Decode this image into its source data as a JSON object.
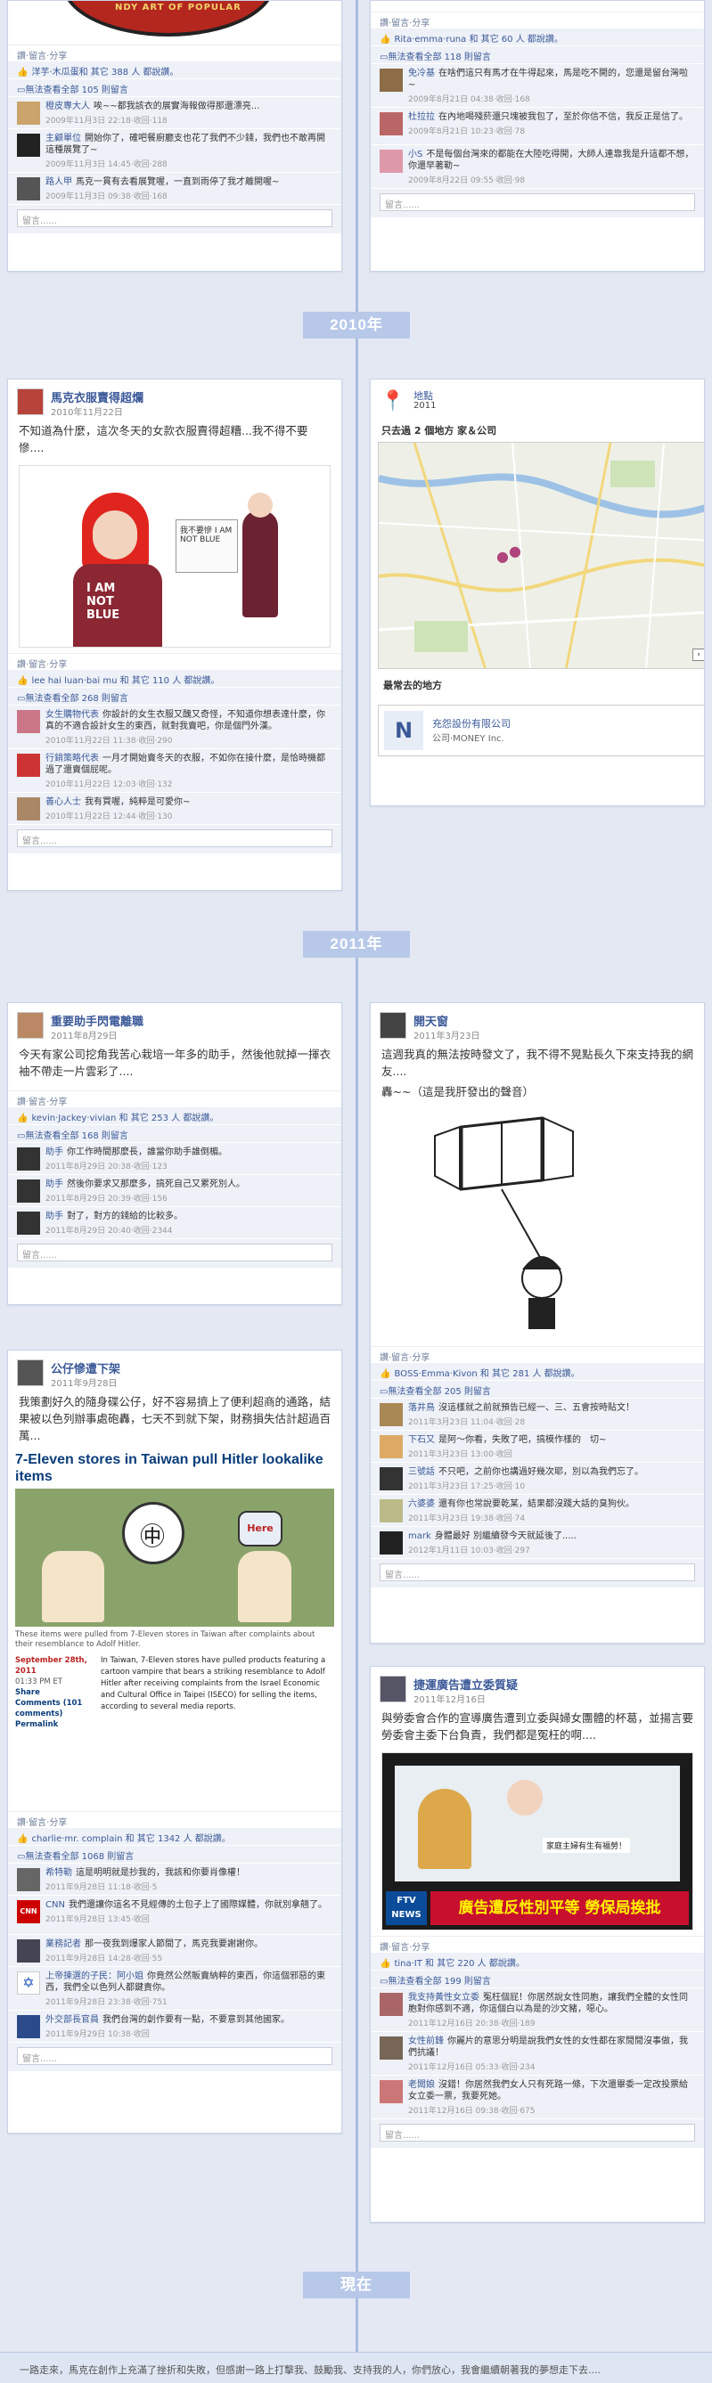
{
  "years": [
    "2010年",
    "2011年",
    "現在"
  ],
  "common": {
    "actions": "讚‧留言‧分享",
    "comment_placeholder": "留言......"
  },
  "cards": {
    "top_left": {
      "likes": "洋芋‧木瓜蛋和 其它 388 人 都說讚。",
      "view_all": "無法查看全部 105 則留言",
      "comments": [
        {
          "name": "橙皮專大人",
          "text": "唉~~都我該衣的展實海報做得那還漂亮...",
          "meta": "2009年11月3日 22:18‧收回‧118"
        },
        {
          "name": "主顧單位",
          "text": "開始你了，確吧餐廚廳支也花了我們不少錢，我們也不敢再開這種展覽了~",
          "meta": "2009年11月3日 14:45‧收回‧288"
        },
        {
          "name": "路人甲",
          "text": "馬克一貫有去看展覽喔，一直到雨停了我才離開喔~",
          "meta": "2009年11月3日 09:38‧收回‧168"
        }
      ]
    },
    "top_right": {
      "likes": "Rita‧emma‧runa 和 其它 60 人 都說讚。",
      "view_all": "無法查看全部 118 則留言",
      "comments": [
        {
          "name": "免冷基",
          "text": "在啥們這只有馬才在牛得起來，馬是吃不開的，您還是留台灣啦~",
          "meta": "2009年8月21日 04:38‧收回‧168"
        },
        {
          "name": "杜拉拉",
          "text": "在內地喝殘菸還只塊被我包了，至於你信不信，我反正是信了。",
          "meta": "2009年8月21日 10:23‧收回‧78"
        },
        {
          "name": "小S",
          "text": "不是每個台灣來的都能在大陸吃得開，大師人連靠我是升這都不想，你還早著勒~",
          "meta": "2009年8月22日 09:55‧收回‧98"
        }
      ]
    },
    "c2010_left": {
      "title": "馬克衣服賣得超爛",
      "date": "2010年11月22日",
      "body": "不知道為什麼，這次冬天的女款衣服賣得超糟...我不得不要慘....",
      "photo_text": "我不要慘 I AM NOT BLUE",
      "likes": "lee hai luan‧bai mu 和 其它 110 人 都說讚。",
      "view_all": "無法查看全部 268 則留言",
      "comments": [
        {
          "name": "女生購物代表",
          "text": "你設計的女生衣服又醜又奇怪，不知道你想表達什麼，你真的不適合設計女生的東西，就對我賣吧，你是個門外漢。",
          "meta": "2010年11月22日 11:38‧收回‧290"
        },
        {
          "name": "行銷策略代表",
          "text": "一月才開始賣冬天的衣服，不如你在接什麼，是恰時機都過了還賣個屁呢。",
          "meta": "2010年11月22日 12:03‧收回‧132"
        },
        {
          "name": "善心人士",
          "text": "我有買喔，純粹是可愛你~",
          "meta": "2010年11月22日 12:44‧收回‧130"
        }
      ]
    },
    "c2010_right": {
      "title": "地點",
      "date": "2011",
      "subtitle": "只去過 2 個地方 家＆公司",
      "map_label": "最常去的地方",
      "place_name": "充怨設份有限公司",
      "place_type": "公司‧MONEY Inc."
    },
    "c2011_a": {
      "title": "重要助手閃電離職",
      "date": "2011年8月29日",
      "body": "今天有家公司挖角我苦心栽培一年多的助手，然後他就掉一揮衣袖不帶走一片雲彩了....",
      "likes": "kevin‧Jackey‧vivian 和 其它 253 人 都說讚。",
      "view_all": "無法查看全部 168 則留言",
      "comments": [
        {
          "name": "助手",
          "text": "你工作時間那麼長，誰當你助手誰倒楣。",
          "meta": "2011年8月29日 20:38‧收回‧123"
        },
        {
          "name": "助手",
          "text": "然後你要求又那麼多，搞死自己又累死別人。",
          "meta": "2011年8月29日 20:39‧收回‧156"
        },
        {
          "name": "助手",
          "text": "對了，對方的錢給的比較多。",
          "meta": "2011年8月29日 20:40‧收回‧2344"
        }
      ]
    },
    "c2011_b": {
      "title": "開天窗",
      "date": "2011年3月23日",
      "body1": "這週我真的無法按時發文了，我不得不晃點長久下來支持我的網友....",
      "body2": "轟~~（這是我肝發出的聲音）",
      "likes": "BOSS‧Emma‧Kivon 和 其它 281 人 都說讚。",
      "view_all": "無法查看全部 205 則留言",
      "comments": [
        {
          "name": "落井鳥",
          "text": "沒這樣就之前就預告已經一、三、五會按時貼文！",
          "meta": "2011年3月23日 11:04‧收回‧28"
        },
        {
          "name": "下石又",
          "text": "是阿～你看，失敗了吧，搞模作樣的　切~",
          "meta": "2011年3月23日 13:00‧收回"
        },
        {
          "name": "三號話",
          "text": "不只吧，之前你也講過好幾次耶，別以為我們忘了。",
          "meta": "2011年3月23日 17:25‧收回‧10"
        },
        {
          "name": "六婆婆",
          "text": "還有你也常說要乾某，結果都沒踐大話的臭狗伙。",
          "meta": "2011年3月23日 19:38‧收回‧74"
        },
        {
          "name": "mark",
          "text": "身體最好 別繼續發今天就延後了.....",
          "meta": "2012年1月11日 10:03‧收回‧297"
        }
      ]
    },
    "c2011_c": {
      "title": "公仔慘遭下架",
      "date": "2011年9月28日",
      "body": "我策劃好久的隨身碟公仔，好不容易擠上了便利超商的通路，結果被以色列辦事處砲轟，七天不到就下架，財務損失估計超過百萬...",
      "headline": "7-Eleven stores in Taiwan pull Hitler lookalike items",
      "caption": "These items were pulled from 7-Eleven stores in Taiwan after complaints about their resemblance to Adolf Hitler.",
      "news_date": "September 28th, 2011",
      "news_time": "01:33 PM ET",
      "news_share": "Share",
      "news_comments": "Comments (101 comments)",
      "news_permalink": "Permalink",
      "news_body": "In Taiwan, 7-Eleven stores have pulled products featuring a cartoon vampire that bears a striking resemblance to Adolf Hitler after receiving complaints from the Israel Economic and Cultural Office in Taipei (ISECO) for selling the items, according to several media reports.",
      "sign_text": "Here",
      "likes": "charlie‧mr. complain 和 其它 1342 人 都說讚。",
      "view_all": "無法查看全部 1068 則留言",
      "comments": [
        {
          "name": "希特勒",
          "text": "這是明明就是抄我的，我該和你要肖像權！",
          "meta": "2011年9月28日 11:18‧收回‧5"
        },
        {
          "name": "CNN",
          "text": "我們還讓你這名不見經傳的土包子上了國際媒體，你就別拿翹了。",
          "meta": "2011年9月28日 13:45‧收回"
        },
        {
          "name": "業務記者",
          "text": "那一夜我到爆家人節間了，馬克我要謝謝你。",
          "meta": "2011年9月28日 14:28‧收回‧55"
        },
        {
          "name": "上帝揀選的子民：阿小姐",
          "text": "你竟然公然販賣納粹的東西，你這個邪惡的東西，我們全以色列人都鍵責你。",
          "meta": "2011年9月28日 23:38‧收回‧751"
        },
        {
          "name": "外交部長官員",
          "text": "我們台灣的創作要有一點，不要意到其他國家。",
          "meta": "2011年9月29日 10:38‧收回"
        }
      ]
    },
    "c2011_d": {
      "title": "捷運廣告遭立委質疑",
      "date": "2011年12月16日",
      "body": "與勞委會合作的宣導廣告遭到立委與婦女團體的杯葛，並揚言要勞委會主委下台負責，我們都是冤枉的啊....",
      "ad_banner": "廣告遭反性別平等 勞保局挨批",
      "ad_sign": "家庭主婦有生有福勞！",
      "ad_logo": "FTV NEWS",
      "likes": "tina‧IT 和 其它 220 人 都說讚。",
      "view_all": "無法查看全部 199 則留言",
      "comments": [
        {
          "name": "我支持黃性女立委",
          "text": "冤枉個屁！你居然說女性同胞，讓我們全體的女性同胞對你感到不適，你這個白以為是的沙文豬，噁心。",
          "meta": "2011年12月16日 20:38‧收回‧189"
        },
        {
          "name": "女性前鋒",
          "text": "你麗片的意思分明是說我們女性的女性都在家閒閒沒事做，我們抗議！",
          "meta": "2011年12月16日 05:33‧收回‧234"
        },
        {
          "name": "老闆娘",
          "text": "沒錯！你居然我們女人只有死路一條，下次還畢委一定改投票給女立委一票，我要死她。",
          "meta": "2011年12月16日 09:38‧收回‧675"
        }
      ]
    }
  },
  "footer": "一路走來，馬克在創作上充滿了挫折和失敗，但感謝一路上打擊我、鼓勵我、支持我的人，你們放心，我會繼續朝著我的夢想走下去...."
}
